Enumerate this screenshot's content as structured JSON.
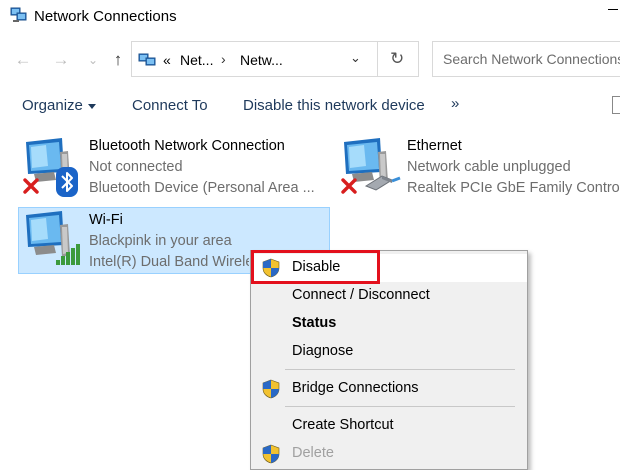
{
  "window": {
    "title": "Network Connections"
  },
  "address": {
    "prefix": "«",
    "crumbs": [
      "Net...",
      "Netw..."
    ],
    "search_placeholder": "Search Network Connections"
  },
  "toolbar": {
    "organize": "Organize",
    "connect_to": "Connect To",
    "disable_device": "Disable this network device",
    "more": "»"
  },
  "connections": [
    {
      "name": "Bluetooth Network Connection",
      "status": "Not connected",
      "device": "Bluetooth Device (Personal Area ..."
    },
    {
      "name": "Ethernet",
      "status": "Network cable unplugged",
      "device": "Realtek PCIe GbE Family Controller"
    },
    {
      "name": "Wi-Fi",
      "status": "Blackpink in your area",
      "device": "Intel(R) Dual Band Wireless-AC"
    }
  ],
  "context_menu": {
    "items": [
      "Disable",
      "Connect / Disconnect",
      "Status",
      "Diagnose",
      "Bridge Connections",
      "Create Shortcut",
      "Delete"
    ]
  },
  "colors": {
    "selection_bg": "#cce8ff",
    "selection_border": "#99d1ff",
    "highlight_box": "#e3101c",
    "toolbar_text": "#1e395b"
  }
}
